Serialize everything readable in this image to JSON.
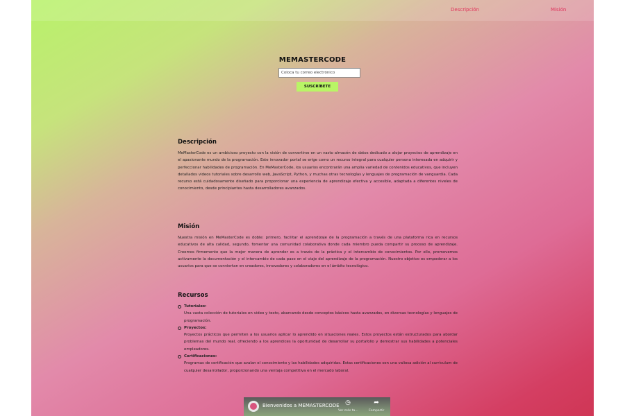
{
  "nav": {
    "items": [
      "Descripción",
      "Misión"
    ]
  },
  "hero": {
    "title": "MEMASTERCODE",
    "email_placeholder": "Coloca tu correo electrónico",
    "subscribe_label": "SUSCRÍBETE"
  },
  "descripcion": {
    "heading": "Descripción",
    "text": "MeMasterCode es un ambicioso proyecto con la visión de convertirse en un vasto almacén de datos dedicado a alojar proyectos de aprendizaje en el apasionante mundo de la programación. Este innovador portal se erige como un recurso integral para cualquier persona interesada en adquirir y perfeccionar habilidades de programación. En MeMasterCode, los usuarios encontrarán una amplia variedad de contenidos educativos, que incluyen detallados videos tutoriales sobre desarrollo web, JavaScript, Python, y muchas otras tecnologías y lenguajes de programación de vanguardia. Cada recurso está cuidadosamente diseñado para proporcionar una experiencia de aprendizaje efectiva y accesible, adaptada a diferentes niveles de conocimiento, desde principiantes hasta desarrolladores avanzados."
  },
  "mision": {
    "heading": "Misión",
    "text": "Nuestra misión en MeMasterCode es doble: primero, facilitar el aprendizaje de la programación a través de una plataforma rica en recursos educativos de alta calidad, segundo, fomentar una comunidad colaborativa donde cada miembro pueda compartir su proceso de aprendizaje. Creemos firmemente que la mejor manera de aprender es a través de la práctica y el intercambio de conocimientos. Por ello, promovemos activamente la documentación y el intercambio de cada paso en el viaje del aprendizaje de la programación. Nuestro objetivo es empoderar a los usuarios para que se conviertan en creadores, innovadores y colaboradores en el ámbito tecnológico."
  },
  "recursos": {
    "heading": "Recursos",
    "items": [
      {
        "title": "Tutoriales:",
        "text": "Una vasta colección de tutoriales en video y texto, abarcando desde conceptos básicos hasta avanzados, en diversas tecnologías y lenguajes de programación."
      },
      {
        "title": "Proyectos:",
        "text": "Proyectos prácticos que permiten a los usuarios aplicar lo aprendido en situaciones reales. Estos proyectos están estructurados para abordar problemas del mundo real, ofreciendo a los aprendices la oportunidad de desarrollar su portafolio y demostrar sus habilidades a potenciales empleadores."
      },
      {
        "title": "Certificaciones:",
        "text": "Programas de certificación que avalan el conocimiento y las habilidades adquiridas. Estas certificaciones son una valiosa adición al currículum de cualquier desarrollador, proporcionando una ventaja competitiva en el mercado laboral."
      }
    ]
  },
  "video": {
    "title": "Bienvenidos a MEMASTERCODE",
    "watch_later_label": "Ver más ta...",
    "share_label": "Compartir",
    "watch_later_icon": "clock-icon",
    "share_icon": "share-arrow-icon"
  },
  "colors": {
    "nav_link": "#e0335b",
    "subscribe_button": "#b9f566",
    "gradient_start": "#b8f26a",
    "gradient_mid": "#e28aaa",
    "gradient_end": "#cf3655"
  }
}
